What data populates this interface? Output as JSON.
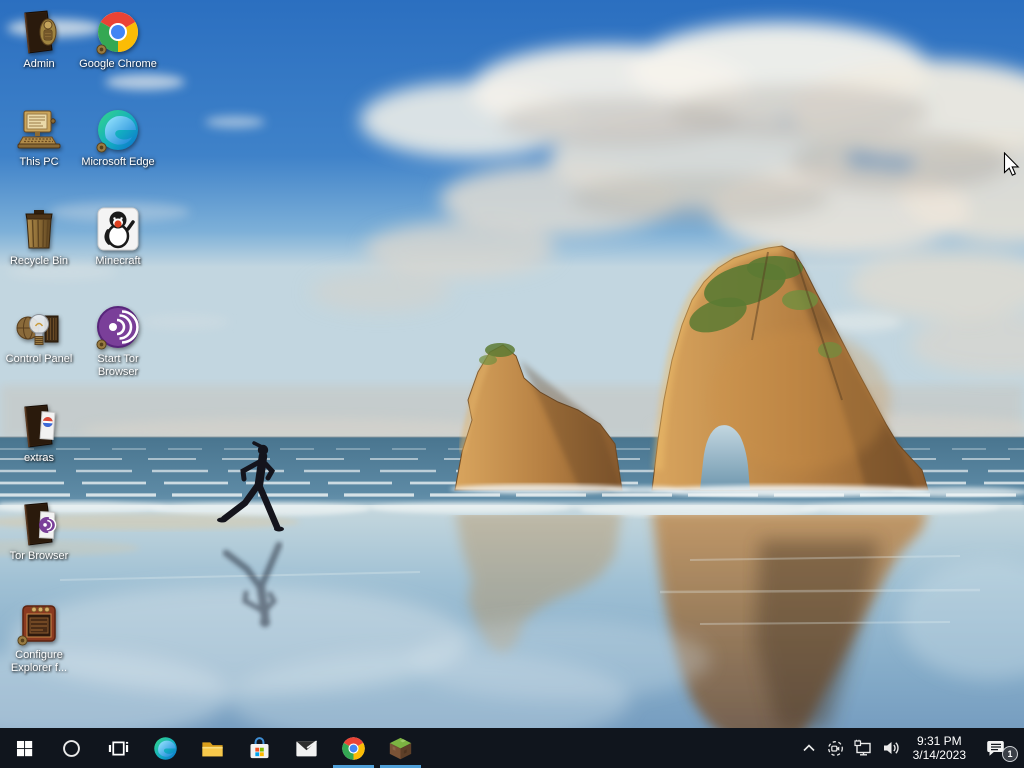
{
  "desktop": {
    "icons": [
      {
        "label": "Admin",
        "icon": "admin-folder-icon"
      },
      {
        "label": "Google Chrome",
        "icon": "chrome-icon"
      },
      {
        "label": "This PC",
        "icon": "this-pc-icon"
      },
      {
        "label": "Microsoft Edge",
        "icon": "edge-icon"
      },
      {
        "label": "Recycle Bin",
        "icon": "recycle-bin-icon"
      },
      {
        "label": "Minecraft",
        "icon": "minecraft-penguin-icon"
      },
      {
        "label": "Control Panel",
        "icon": "control-panel-icon"
      },
      {
        "label": "Start Tor Browser",
        "icon": "tor-onion-icon"
      },
      {
        "label": "extras",
        "icon": "folder-extras-icon"
      },
      {
        "label": "Tor Browser",
        "icon": "folder-tor-icon"
      },
      {
        "label": "Configure Explorer f...",
        "icon": "configure-explorer-icon"
      }
    ]
  },
  "taskbar": {
    "buttons": [
      {
        "name": "start",
        "icon": "windows-start-icon"
      },
      {
        "name": "cortana-search",
        "icon": "cortana-circle-icon"
      },
      {
        "name": "task-view",
        "icon": "task-view-icon"
      },
      {
        "name": "microsoft-edge",
        "icon": "edge-icon",
        "active": false
      },
      {
        "name": "file-explorer",
        "icon": "file-explorer-icon",
        "active": false
      },
      {
        "name": "microsoft-store",
        "icon": "store-bag-icon",
        "active": false
      },
      {
        "name": "mail",
        "icon": "mail-envelope-icon",
        "active": false
      },
      {
        "name": "google-chrome",
        "icon": "chrome-icon",
        "active": true
      },
      {
        "name": "minecraft",
        "icon": "minecraft-block-icon",
        "active": true
      }
    ],
    "tray": {
      "icons": [
        "chevron-up-icon",
        "meet-now-icon",
        "network-icon",
        "volume-icon"
      ],
      "time": "9:31 PM",
      "date": "3/14/2023",
      "action_center": {
        "icon": "action-center-icon",
        "badge": "1"
      }
    }
  },
  "colors": {
    "taskbar_bg": "#10151d",
    "active_indicator": "#4f9fd8",
    "desktop_label": "#ffffff",
    "tor_purple": "#7a3f99",
    "sky_blue": "#2b6fc0"
  }
}
